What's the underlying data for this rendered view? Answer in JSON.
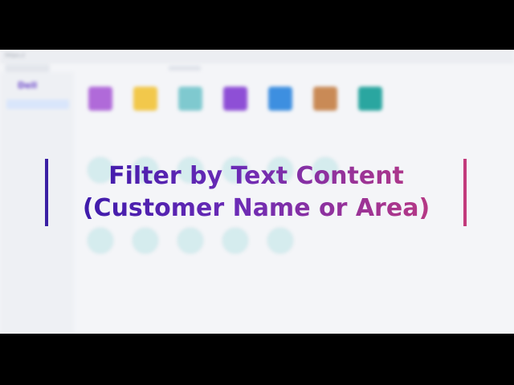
{
  "app": {
    "address_text": "https://",
    "brand": "Dell",
    "sidebar": {
      "items": [
        {
          "label": "",
          "active": true
        },
        {
          "label": "",
          "active": false
        },
        {
          "label": "",
          "active": false
        },
        {
          "label": "",
          "active": false
        },
        {
          "label": "",
          "active": false
        },
        {
          "label": "",
          "active": false
        },
        {
          "label": "",
          "active": false
        },
        {
          "label": "",
          "active": false
        },
        {
          "label": "",
          "active": false
        },
        {
          "label": "",
          "active": false
        },
        {
          "label": "",
          "active": false
        }
      ]
    },
    "tiles_row1": [
      {
        "label": "",
        "color": "#b06ad9"
      },
      {
        "label": "",
        "color": "#f2c84b"
      },
      {
        "label": "",
        "color": "#7fc9cf"
      },
      {
        "label": "",
        "color": "#8e4fd6"
      },
      {
        "label": "",
        "color": "#3d8fe0"
      },
      {
        "label": "",
        "color": "#c98a56"
      },
      {
        "label": "",
        "color": "#2aa6a0"
      }
    ],
    "tiles_row2": [
      {
        "label": ""
      },
      {
        "label": ""
      },
      {
        "label": ""
      },
      {
        "label": ""
      },
      {
        "label": ""
      },
      {
        "label": ""
      }
    ],
    "tiles_row3": [
      {
        "label": ""
      },
      {
        "label": ""
      },
      {
        "label": ""
      },
      {
        "label": ""
      },
      {
        "label": ""
      }
    ]
  },
  "overlay": {
    "line1": "Filter by Text Content",
    "line2": "(Customer Name or Area)",
    "gradient_start": "#3517a8",
    "gradient_end": "#c23a7c"
  }
}
